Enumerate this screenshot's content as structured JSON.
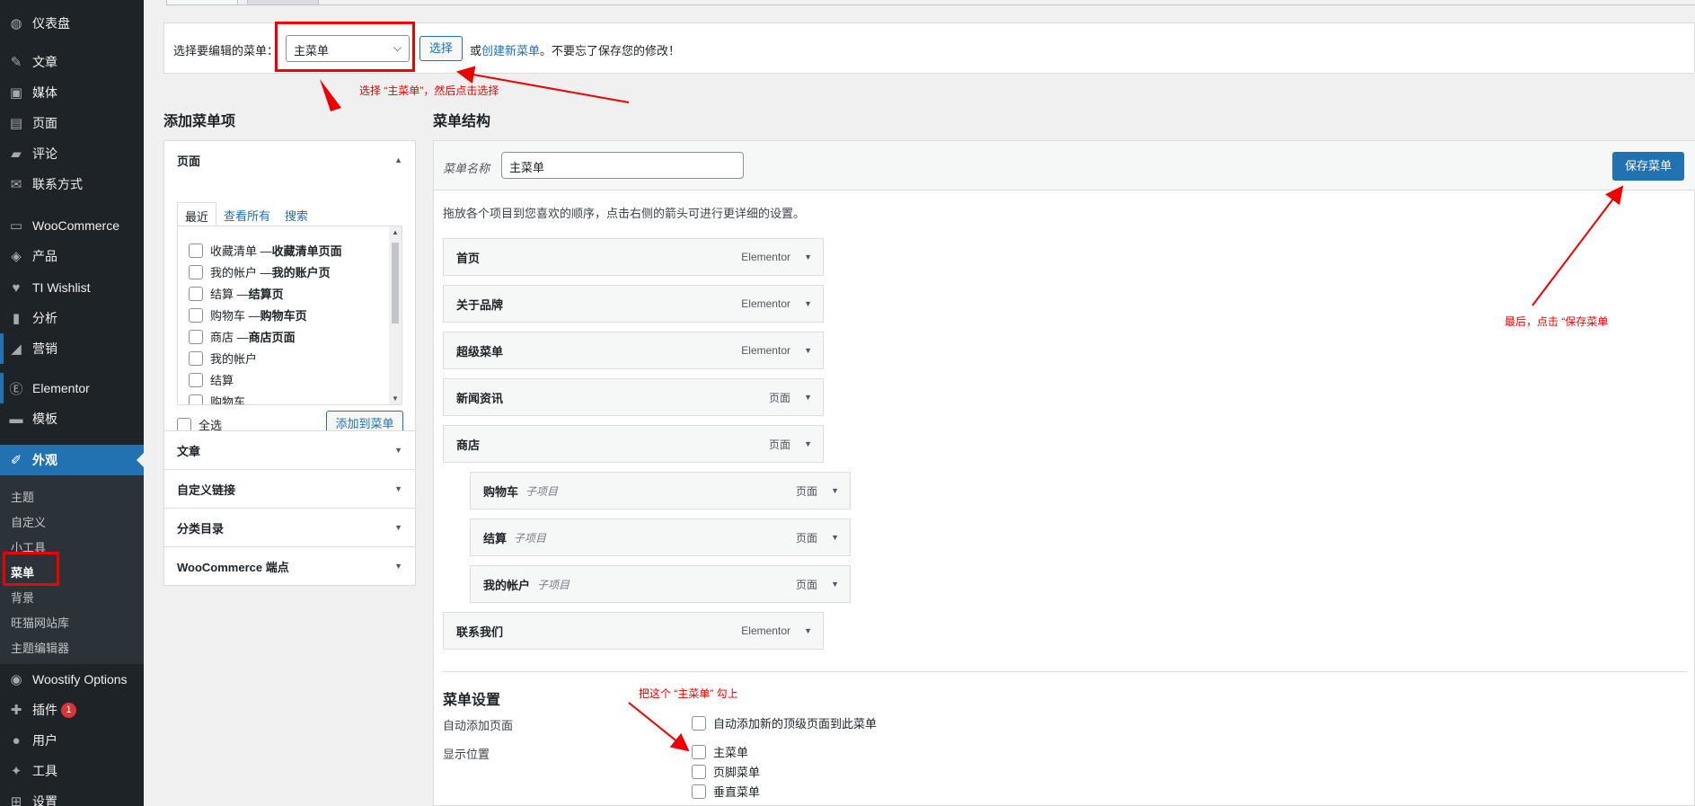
{
  "sidebar": {
    "items": [
      {
        "label": "仪表盘",
        "icon": "dashboard-icon",
        "glyph": "◍"
      },
      {
        "label": "文章",
        "icon": "pin-icon",
        "glyph": "✎"
      },
      {
        "label": "媒体",
        "icon": "media-icon",
        "glyph": "▣"
      },
      {
        "label": "页面",
        "icon": "page-icon",
        "glyph": "▤"
      },
      {
        "label": "评论",
        "icon": "comment-icon",
        "glyph": "▰"
      },
      {
        "label": "联系方式",
        "icon": "mail-icon",
        "glyph": "✉"
      },
      {
        "label": "WooCommerce",
        "icon": "woo-icon",
        "glyph": "▭"
      },
      {
        "label": "产品",
        "icon": "product-icon",
        "glyph": "◈"
      },
      {
        "label": "TI Wishlist",
        "icon": "heart-icon",
        "glyph": "♥"
      },
      {
        "label": "分析",
        "icon": "chart-icon",
        "glyph": "▮"
      },
      {
        "label": "营销",
        "icon": "megaphone-icon",
        "glyph": "◢"
      },
      {
        "label": "Elementor",
        "icon": "elementor-icon",
        "glyph": "Ⓔ"
      },
      {
        "label": "模板",
        "icon": "folder-icon",
        "glyph": "▬"
      },
      {
        "label": "外观",
        "icon": "brush-icon",
        "glyph": "✐"
      },
      {
        "label": "Woostify Options",
        "icon": "woostify-icon",
        "glyph": "◉"
      },
      {
        "label": "插件",
        "icon": "plugin-icon",
        "glyph": "✚"
      },
      {
        "label": "用户",
        "icon": "user-icon",
        "glyph": "●"
      },
      {
        "label": "工具",
        "icon": "wrench-icon",
        "glyph": "✦"
      },
      {
        "label": "设置",
        "icon": "settings-icon",
        "glyph": "⊞"
      }
    ],
    "plugin_badge": "1",
    "submenu": [
      "主题",
      "自定义",
      "小工具",
      "菜单",
      "背景",
      "旺猫网站库",
      "主题编辑器"
    ]
  },
  "select_bar": {
    "label": "选择要编辑的菜单：",
    "selected": "主菜单",
    "select_button": "选择",
    "hint_prefix": "或",
    "create_link": "创建新菜单",
    "hint_suffix": "。不要忘了保存您的修改！"
  },
  "annotations": {
    "select_note": "选择 “主菜单”，然后点击选择",
    "save_note": "最后，点击 “保存菜单",
    "check_note": "把这个 “主菜单” 勾上"
  },
  "add_items": {
    "title": "添加菜单项",
    "pages_panel": "页面",
    "tabs": [
      "最近",
      "查看所有",
      "搜索"
    ],
    "pages": [
      {
        "plain": "收藏清单 — ",
        "bold": "收藏清单页面"
      },
      {
        "plain": "我的帐户 — ",
        "bold": "我的账户页"
      },
      {
        "plain": "结算 — ",
        "bold": "结算页"
      },
      {
        "plain": "购物车 — ",
        "bold": "购物车页"
      },
      {
        "plain": "商店 — ",
        "bold": "商店页面"
      },
      {
        "plain": "我的帐户",
        "bold": ""
      },
      {
        "plain": "结算",
        "bold": ""
      },
      {
        "plain": "购物车",
        "bold": ""
      }
    ],
    "select_all": "全选",
    "add_button": "添加到菜单",
    "panels": [
      "文章",
      "自定义链接",
      "分类目录",
      "WooCommerce 端点"
    ]
  },
  "structure": {
    "title": "菜单结构",
    "name_label": "菜单名称",
    "name_value": "主菜单",
    "save_button": "保存菜单",
    "hint": "拖放各个项目到您喜欢的顺序，点击右侧的箭头可进行更详细的设置。",
    "items": [
      {
        "label": "首页",
        "type": "Elementor",
        "sub": ""
      },
      {
        "label": "关于品牌",
        "type": "Elementor",
        "sub": ""
      },
      {
        "label": "超级菜单",
        "type": "Elementor",
        "sub": ""
      },
      {
        "label": "新闻资讯",
        "type": "页面",
        "sub": ""
      },
      {
        "label": "商店",
        "type": "页面",
        "sub": ""
      },
      {
        "label": "购物车",
        "type": "页面",
        "sub": "子项目"
      },
      {
        "label": "结算",
        "type": "页面",
        "sub": "子项目"
      },
      {
        "label": "我的帐户",
        "type": "页面",
        "sub": "子项目"
      },
      {
        "label": "联系我们",
        "type": "Elementor",
        "sub": ""
      }
    ]
  },
  "settings": {
    "title": "菜单设置",
    "auto_add_label": "自动添加页面",
    "auto_add_option": "自动添加新的顶级页面到此菜单",
    "location_label": "显示位置",
    "locations": [
      "主菜单",
      "页脚菜单",
      "垂直菜单"
    ]
  },
  "colors": {
    "accent": "#2271b1",
    "annotation": "#e00000",
    "sidebar": "#1d2327"
  }
}
